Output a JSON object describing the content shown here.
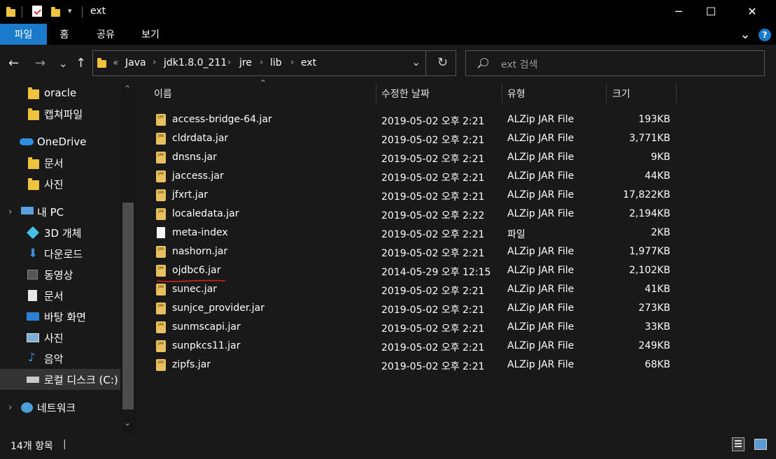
{
  "window": {
    "title": "ext",
    "minimize": "─",
    "maximize": "☐",
    "close": "✕"
  },
  "ribbon": {
    "tabs": [
      "파일",
      "홈",
      "공유",
      "보기"
    ],
    "expand": "⌄",
    "help": "?"
  },
  "nav": {
    "back": "←",
    "forward": "→",
    "recent": "⌄",
    "up": "↑",
    "overflow": "«",
    "breadcrumbs": [
      "Java",
      "jdk1.8.0_211",
      "jre",
      "lib",
      "ext"
    ],
    "crumb_sep": "›",
    "dropdown": "⌄",
    "refresh": "↻",
    "search_placeholder": "ext 검색"
  },
  "sidebar": {
    "scroll_up": "⌃",
    "scroll_down": "⌄",
    "expand": "›",
    "items": [
      {
        "label": "oracle",
        "icon": "folder-icon"
      },
      {
        "label": "캡쳐파일",
        "icon": "folder-icon"
      },
      {
        "label": "OneDrive",
        "icon": "cloud-icon"
      },
      {
        "label": "문서",
        "icon": "folder-icon"
      },
      {
        "label": "사진",
        "icon": "folder-icon"
      },
      {
        "label": "내 PC",
        "icon": "computer-icon"
      },
      {
        "label": "3D 개체",
        "icon": "cube-icon"
      },
      {
        "label": "다운로드",
        "icon": "download-icon"
      },
      {
        "label": "동영상",
        "icon": "video-icon"
      },
      {
        "label": "문서",
        "icon": "document-icon"
      },
      {
        "label": "바탕 화면",
        "icon": "desktop-icon"
      },
      {
        "label": "사진",
        "icon": "picture-icon"
      },
      {
        "label": "음악",
        "icon": "music-icon"
      },
      {
        "label": "로컬 디스크 (C:)",
        "icon": "drive-icon"
      },
      {
        "label": "네트워크",
        "icon": "network-icon"
      }
    ]
  },
  "list": {
    "sort_arrow": "⌃",
    "columns": {
      "name": "이름",
      "modified": "수정한 날짜",
      "type": "유형",
      "size": "크기"
    },
    "rows": [
      {
        "name": "access-bridge-64.jar",
        "modified": "2019-05-02 오후 2:21",
        "type": "ALZip JAR File",
        "size": "193KB",
        "icon": "jar-icon"
      },
      {
        "name": "cldrdata.jar",
        "modified": "2019-05-02 오후 2:21",
        "type": "ALZip JAR File",
        "size": "3,771KB",
        "icon": "jar-icon"
      },
      {
        "name": "dnsns.jar",
        "modified": "2019-05-02 오후 2:21",
        "type": "ALZip JAR File",
        "size": "9KB",
        "icon": "jar-icon"
      },
      {
        "name": "jaccess.jar",
        "modified": "2019-05-02 오후 2:21",
        "type": "ALZip JAR File",
        "size": "44KB",
        "icon": "jar-icon"
      },
      {
        "name": "jfxrt.jar",
        "modified": "2019-05-02 오후 2:21",
        "type": "ALZip JAR File",
        "size": "17,822KB",
        "icon": "jar-icon"
      },
      {
        "name": "localedata.jar",
        "modified": "2019-05-02 오후 2:22",
        "type": "ALZip JAR File",
        "size": "2,194KB",
        "icon": "jar-icon"
      },
      {
        "name": "meta-index",
        "modified": "2019-05-02 오후 2:21",
        "type": "파일",
        "size": "2KB",
        "icon": "file-icon"
      },
      {
        "name": "nashorn.jar",
        "modified": "2019-05-02 오후 2:21",
        "type": "ALZip JAR File",
        "size": "1,977KB",
        "icon": "jar-icon"
      },
      {
        "name": "ojdbc6.jar",
        "modified": "2014-05-29 오후 12:15",
        "type": "ALZip JAR File",
        "size": "2,102KB",
        "icon": "jar-icon"
      },
      {
        "name": "sunec.jar",
        "modified": "2019-05-02 오후 2:21",
        "type": "ALZip JAR File",
        "size": "41KB",
        "icon": "jar-icon"
      },
      {
        "name": "sunjce_provider.jar",
        "modified": "2019-05-02 오후 2:21",
        "type": "ALZip JAR File",
        "size": "273KB",
        "icon": "jar-icon"
      },
      {
        "name": "sunmscapi.jar",
        "modified": "2019-05-02 오후 2:21",
        "type": "ALZip JAR File",
        "size": "33KB",
        "icon": "jar-icon"
      },
      {
        "name": "sunpkcs11.jar",
        "modified": "2019-05-02 오후 2:21",
        "type": "ALZip JAR File",
        "size": "249KB",
        "icon": "jar-icon"
      },
      {
        "name": "zipfs.jar",
        "modified": "2019-05-02 오후 2:21",
        "type": "ALZip JAR File",
        "size": "68KB",
        "icon": "jar-icon"
      }
    ]
  },
  "status": {
    "count": "14개 항목",
    "divider": "|"
  },
  "colors": {
    "accent": "#1979ca",
    "annotation": "#d42020"
  }
}
